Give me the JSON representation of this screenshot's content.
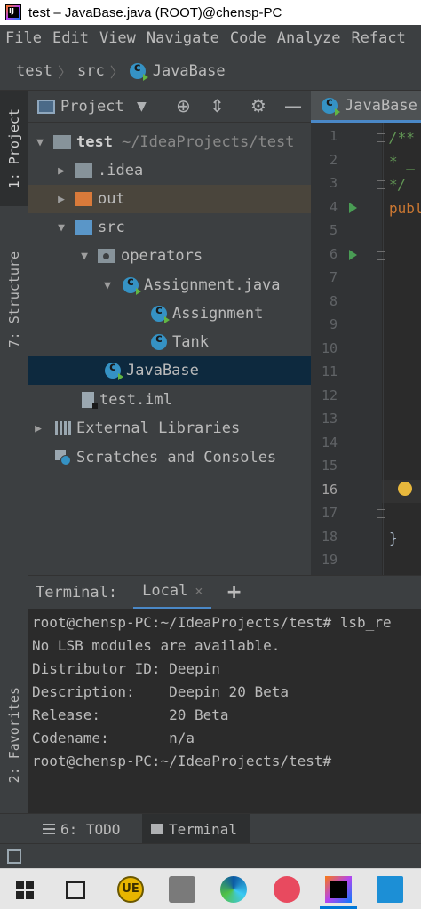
{
  "window": {
    "title": "test – JavaBase.java (ROOT)@chensp-PC"
  },
  "menu": [
    {
      "label": "File",
      "mnemonic": "F",
      "rest": "ile"
    },
    {
      "label": "Edit",
      "mnemonic": "E",
      "rest": "dit"
    },
    {
      "label": "View",
      "mnemonic": "V",
      "rest": "iew"
    },
    {
      "label": "Navigate",
      "mnemonic": "N",
      "rest": "avigate"
    },
    {
      "label": "Code",
      "mnemonic": "C",
      "rest": "ode"
    },
    {
      "label": "Analyze",
      "mnemonic": "",
      "rest": "Analyze"
    },
    {
      "label": "Refact",
      "mnemonic": "",
      "rest": "Refact"
    }
  ],
  "breadcrumb": {
    "project": "test",
    "folder": "src",
    "file": "JavaBase"
  },
  "side_tabs": {
    "project": "1: Project",
    "structure": "7: Structure",
    "favorites": "2: Favorites"
  },
  "project_panel": {
    "title": "Project",
    "tree": {
      "root_name": "test",
      "root_path": "~/IdeaProjects/test",
      "idea": ".idea",
      "out": "out",
      "src": "src",
      "operators": "operators",
      "assignment_java": "Assignment.java",
      "assignment_class": "Assignment",
      "tank_class": "Tank",
      "javabase": "JavaBase",
      "test_iml": "test.iml",
      "external_libraries": "External Libraries",
      "scratches": "Scratches and Consoles"
    }
  },
  "editor": {
    "tab_label": "JavaBase",
    "line_numbers": [
      "1",
      "2",
      "3",
      "4",
      "5",
      "6",
      "7",
      "8",
      "9",
      "10",
      "11",
      "12",
      "13",
      "14",
      "15",
      "16",
      "17",
      "18",
      "19"
    ],
    "current_line": "16",
    "code": {
      "l1": "/**",
      "l2": " * _",
      "l3": " */",
      "l4": "publ",
      "l18": "}"
    }
  },
  "terminal": {
    "title": "Terminal:",
    "tab_local": "Local",
    "close_glyph": "×",
    "add_glyph": "+",
    "lines": [
      "root@chensp-PC:~/IdeaProjects/test# lsb_re",
      "No LSB modules are available.",
      "Distributor ID: Deepin",
      "Description:    Deepin 20 Beta",
      "Release:        20 Beta",
      "Codename:       n/a",
      "root@chensp-PC:~/IdeaProjects/test#"
    ]
  },
  "bottom_tabs": {
    "todo": "6: TODO",
    "terminal": "Terminal"
  },
  "taskbar": {
    "ue_label": "UE"
  },
  "colors": {
    "accent": "#4a88c7",
    "selection": "#0d293e",
    "excluded_folder": "#d97a3a",
    "source_folder": "#5a96c8",
    "class_icon": "#3592c4",
    "run_green": "#499c54"
  }
}
